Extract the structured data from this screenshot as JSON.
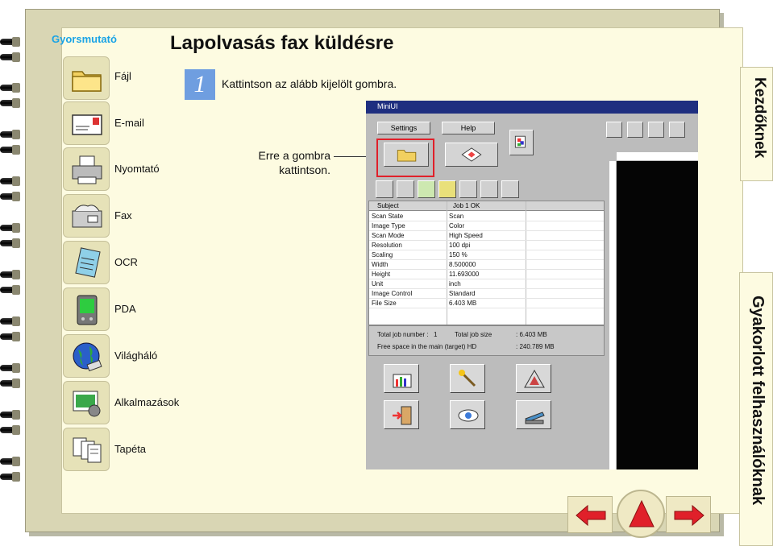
{
  "brand": "Gyorsmutató",
  "title": "Lapolvasás fax küldésre",
  "sidebar": {
    "items": [
      {
        "label": "Fájl",
        "icon": "folder-icon"
      },
      {
        "label": "E-mail",
        "icon": "envelope-icon"
      },
      {
        "label": "Nyomtató",
        "icon": "printer-icon"
      },
      {
        "label": "Fax",
        "icon": "fax-icon"
      },
      {
        "label": "OCR",
        "icon": "ocr-notepad-icon"
      },
      {
        "label": "PDA",
        "icon": "pda-icon"
      },
      {
        "label": "Világháló",
        "icon": "globe-icon"
      },
      {
        "label": "Alkalmazások",
        "icon": "applications-icon"
      },
      {
        "label": "Tapéta",
        "icon": "wallpaper-icon"
      }
    ]
  },
  "step": {
    "number": "1",
    "instruction": "Kattintson az alább kijelölt gombra.",
    "callout_line1": "Erre a gombra",
    "callout_line2": "kattintson."
  },
  "screenshot": {
    "window_title": "MiniUI",
    "settings_label": "Settings",
    "help_label": "Help",
    "table_headers": [
      "Subject",
      "Job 1    OK"
    ],
    "rows": [
      [
        "Scan State",
        "Scan"
      ],
      [
        "Image Type",
        "Color"
      ],
      [
        "Scan Mode",
        "High Speed"
      ],
      [
        "Resolution",
        "100 dpi"
      ],
      [
        "Scaling",
        "150 %"
      ],
      [
        "Width",
        "8.500000"
      ],
      [
        "Height",
        "11.693000"
      ],
      [
        "Unit",
        "inch"
      ],
      [
        "Image Control",
        "Standard"
      ],
      [
        "File Size",
        "6.403   MB"
      ]
    ],
    "totals": {
      "job_number_label": "Total job number :",
      "job_number_value": "1",
      "job_size_label": "Total job size",
      "job_size_value": ":    6.403   MB",
      "free_space_label": "Free space in the main (target) HD",
      "free_space_value": ":    240.789 MB"
    }
  },
  "tabs": {
    "start": "Kezdőknek",
    "advanced": "Gyakorlott felhasználóknak"
  },
  "colors": {
    "brand": "#19a3e6",
    "step_badge": "#6f9ee0",
    "highlight": "#e0202a",
    "nav_arrow": "#e0202a",
    "page": "#fdfbe1"
  }
}
